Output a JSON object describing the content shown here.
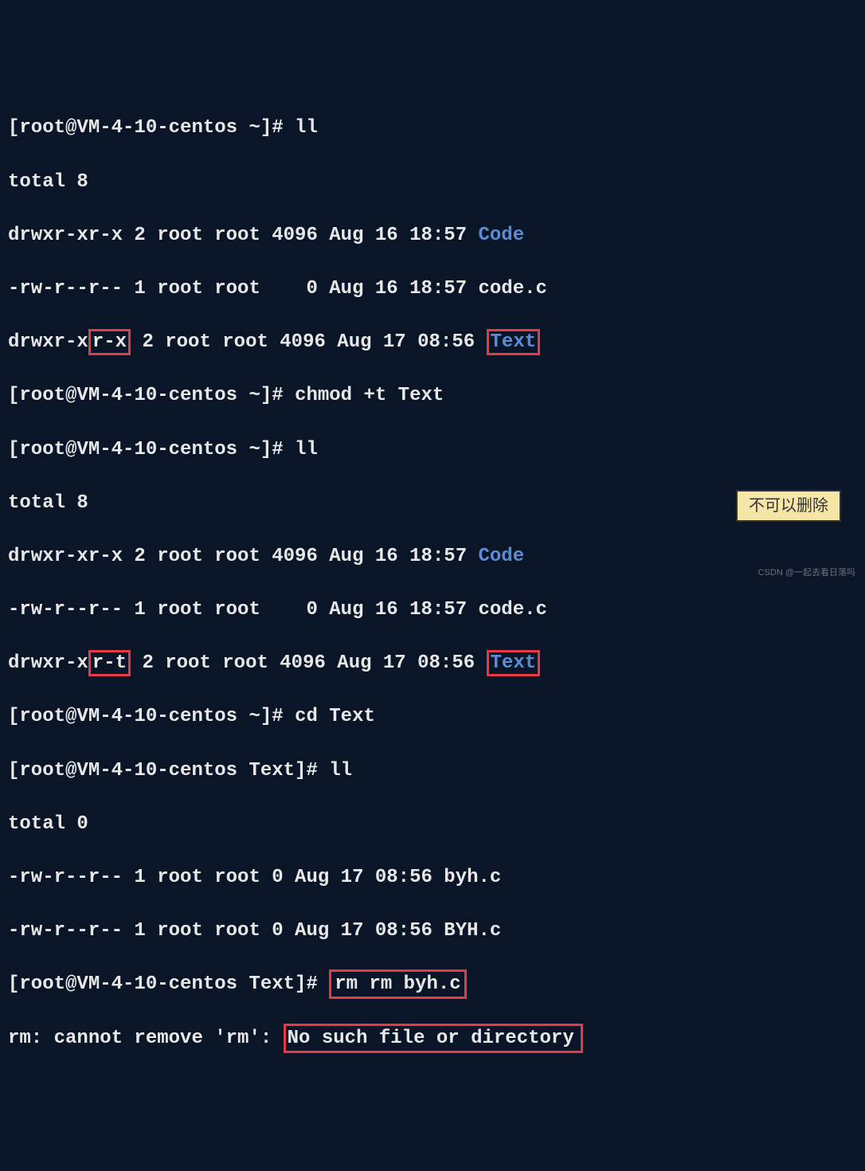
{
  "terminal": {
    "prompt_home": "[root@VM-4-10-centos ~]# ",
    "prompt_text": "[root@VM-4-10-centos Text]# ",
    "lines": {
      "l1_cmd": "ll",
      "l2": "total 8",
      "l3_p1": "drwxr-xr-x 2 root root 4096 Aug 16 18:57 ",
      "l3_dir": "Code",
      "l4": "-rw-r--r-- 1 root root    0 Aug 16 18:57 code.c",
      "l5_p1": "drwxr-x",
      "l5_boxed": "r-x",
      "l5_p2": " 2 root root 4096 Aug 17 08:56 ",
      "l5_dir": "Text",
      "l6_cmd": "chmod +t Text",
      "l7_cmd": "ll",
      "l8": "total 8",
      "l9_p1": "drwxr-xr-x 2 root root 4096 Aug 16 18:57 ",
      "l9_dir": "Code",
      "l10": "-rw-r--r-- 1 root root    0 Aug 16 18:57 code.c",
      "l11_p1": "drwxr-x",
      "l11_boxed": "r-t",
      "l11_p2": " 2 root root 4096 Aug 17 08:56 ",
      "l11_dir": "Text",
      "l12_cmd": "cd Text",
      "l13_cmd": "ll",
      "l14": "total 0",
      "l15": "-rw-r--r-- 1 root root 0 Aug 17 08:56 byh.c",
      "l16": "-rw-r--r-- 1 root root 0 Aug 17 08:56 BYH.c",
      "l17_cmd": "rm rm byh.c",
      "l18_p1": "rm: cannot remove 'rm': ",
      "l18_err": "No such file or directory"
    }
  },
  "note": "不可以删除",
  "watermark": "CSDN @一起去看日落吗"
}
